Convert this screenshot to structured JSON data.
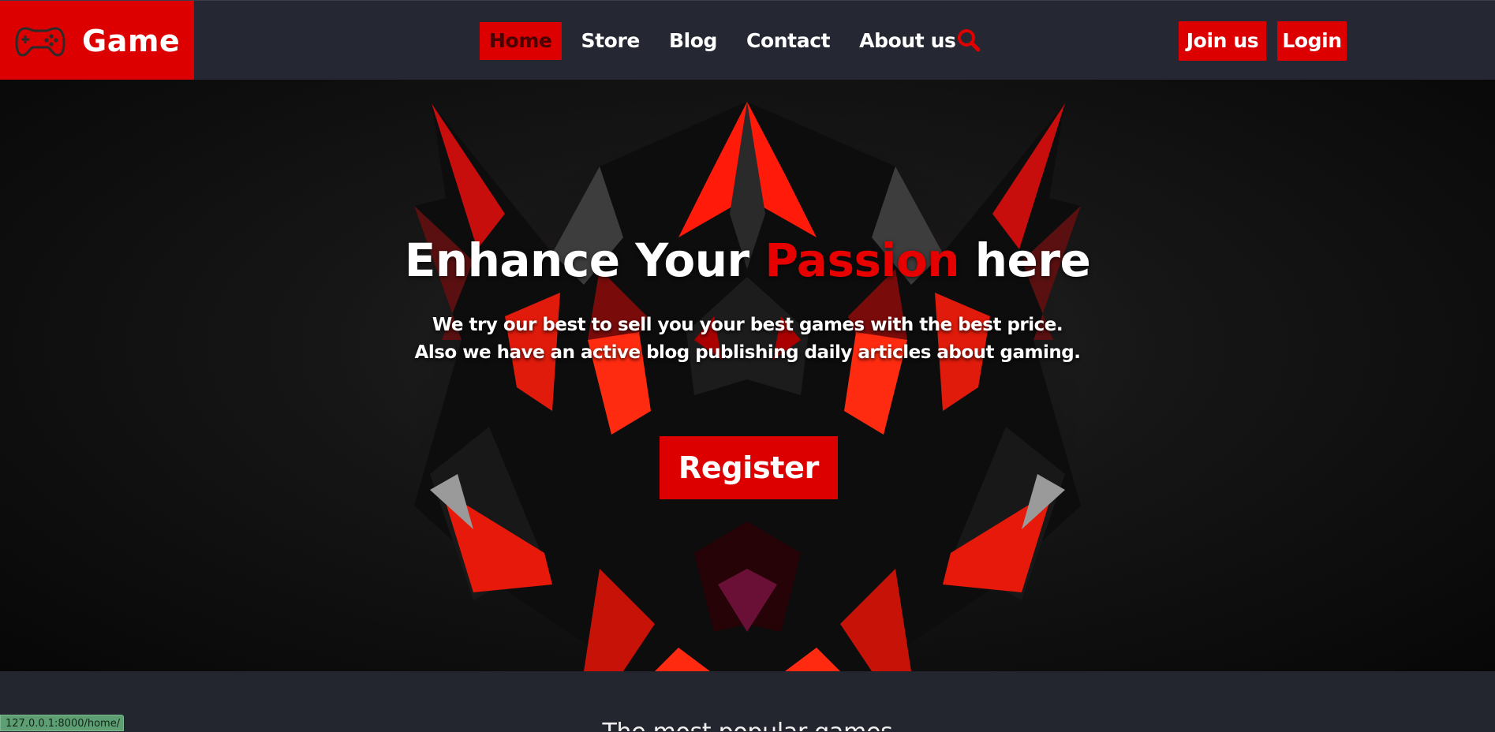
{
  "brand": {
    "name": "Game",
    "icon": "gamepad-icon"
  },
  "nav": {
    "items": [
      {
        "label": "Home",
        "active": true
      },
      {
        "label": "Store",
        "active": false
      },
      {
        "label": "Blog",
        "active": false
      },
      {
        "label": "Contact",
        "active": false
      },
      {
        "label": "About us",
        "active": false
      }
    ],
    "search_icon": "search-icon"
  },
  "auth": {
    "join_label": "Join us",
    "login_label": "Login"
  },
  "hero": {
    "title_before": "Enhance Your ",
    "title_accent": "Passion",
    "title_after": " here",
    "subtitle_line1": "We try our best to sell you your best games with the best price.",
    "subtitle_line2": "Also we have an active blog publishing daily articles about gaming.",
    "register_label": "Register"
  },
  "section": {
    "title": "The most popular games"
  },
  "status_bar": {
    "url": "127.0.0.1:8000/home/"
  },
  "colors": {
    "accent": "#dc0000",
    "header_bg": "#252733",
    "page_bg": "#23252f"
  }
}
